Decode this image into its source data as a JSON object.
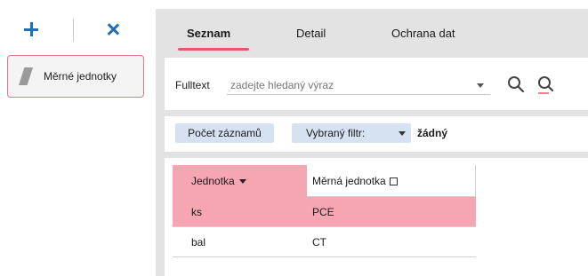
{
  "toolbar": {
    "add_icon": "plus-icon",
    "close_icon": "close-icon"
  },
  "modules": [
    {
      "label": "Měrné jednotky",
      "icon": "ruler-icon"
    }
  ],
  "tabs": [
    {
      "label": "Seznam",
      "active": true
    },
    {
      "label": "Detail",
      "active": false
    },
    {
      "label": "Ochrana dat",
      "active": false
    }
  ],
  "search": {
    "label": "Fulltext",
    "placeholder": "zadejte hledaný výraz",
    "value": ""
  },
  "filter": {
    "count_label": "Počet záznamů",
    "selected_filter_label": "Vybraný filtr:",
    "selected_filter_value": "žádný"
  },
  "grid": {
    "columns": [
      "Jednotka",
      "Měrná jednotka"
    ],
    "rows": [
      {
        "jednotka": "ks",
        "merna_jednotka": "PCE",
        "selected": true
      },
      {
        "jednotka": "bal",
        "merna_jednotka": "CT",
        "selected": false
      }
    ]
  },
  "colors": {
    "accent": "#1f6fb8",
    "highlight": "#f6a6b2",
    "tab_underline": "#e8566e",
    "filter_bg": "#d6e2f2"
  }
}
